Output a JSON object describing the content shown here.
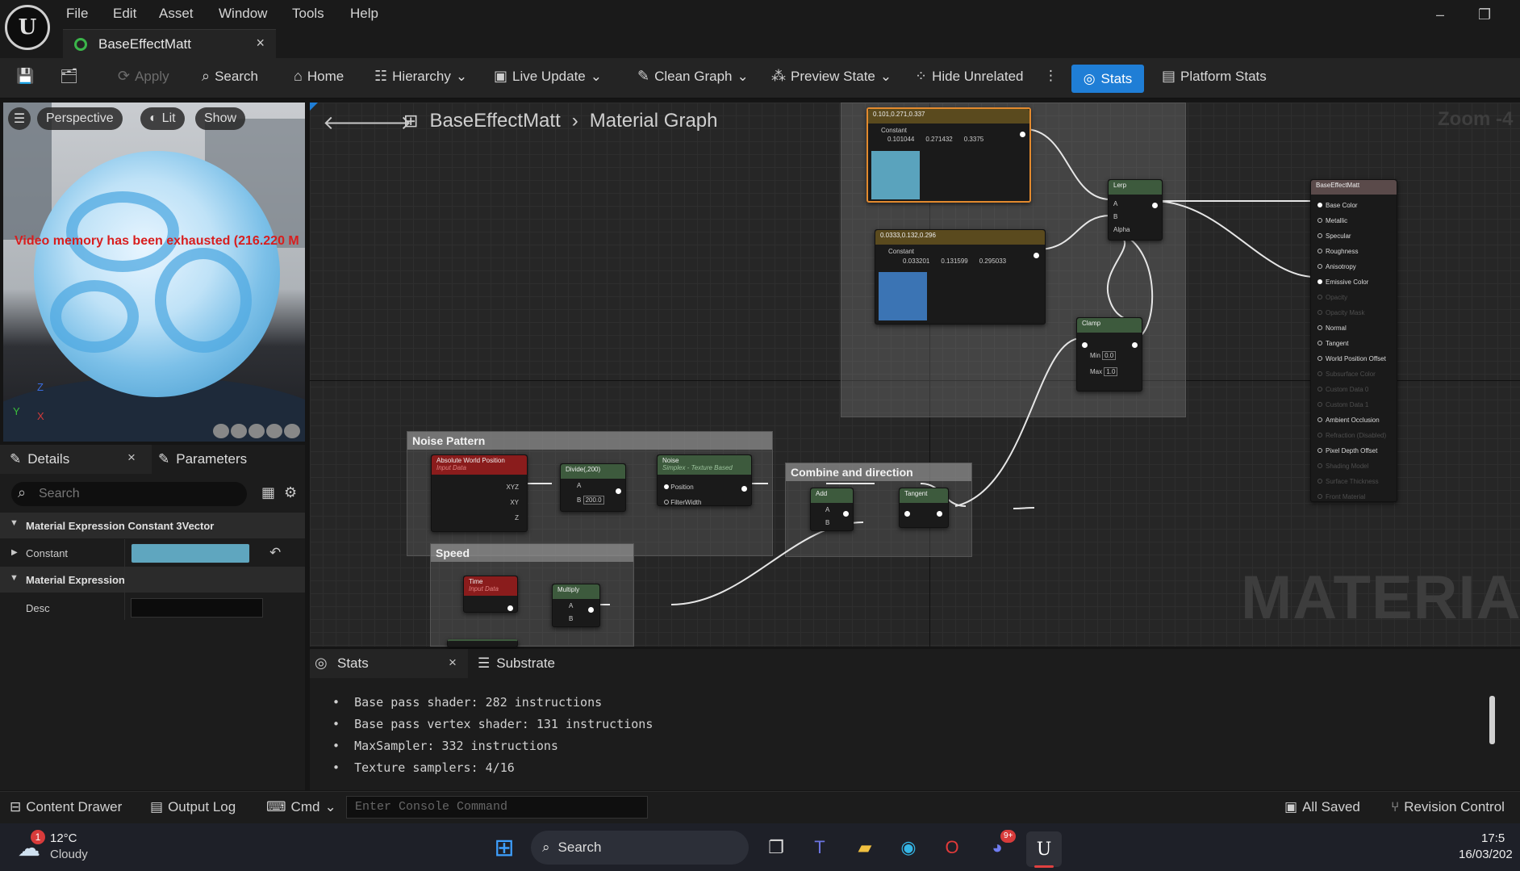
{
  "window": {
    "doc_tab": "BaseEffectMatt",
    "menu": [
      "File",
      "Edit",
      "Asset",
      "Window",
      "Tools",
      "Help"
    ]
  },
  "toolbar": {
    "apply": "Apply",
    "search": "Search",
    "home": "Home",
    "hierarchy": "Hierarchy",
    "live_update": "Live Update",
    "clean_graph": "Clean Graph",
    "preview_state": "Preview State",
    "hide_unrelated": "Hide Unrelated",
    "stats": "Stats",
    "platform_stats": "Platform Stats"
  },
  "viewport": {
    "perspective": "Perspective",
    "lit": "Lit",
    "show": "Show",
    "warning": "Video memory has been exhausted (216.220 M"
  },
  "details": {
    "tab_details": "Details",
    "tab_parameters": "Parameters",
    "search_placeholder": "Search",
    "section1": "Material Expression Constant 3Vector",
    "constant_label": "Constant",
    "constant_color": "#5fa6bf",
    "section2": "Material Expression",
    "desc_label": "Desc"
  },
  "graph": {
    "crumb_root": "BaseEffectMatt",
    "crumb_leaf": "Material Graph",
    "zoom": "Zoom -4",
    "watermark": "MATERIAL",
    "comments": {
      "noise": "Noise Pattern",
      "combine": "Combine and direction",
      "speed": "Speed"
    },
    "nodes": {
      "abs_title": "Absolute World Position",
      "abs_sub": "Input Data",
      "abs_pins": [
        "XYZ",
        "XY",
        "Z"
      ],
      "divide_title": "Divide(,200)",
      "divide_a": "A",
      "divide_b": "B",
      "divide_b_val": "200.0",
      "noise_title": "Noise",
      "noise_sub": "Simplex - Texture Based",
      "noise_pins": [
        "Position",
        "FilterWidth"
      ],
      "add_title": "Add",
      "add_pins": [
        "A",
        "B"
      ],
      "tangent_title": "Tangent",
      "time_title": "Time",
      "time_sub": "Input Data",
      "mult_title": "Multiply",
      "mult_pins": [
        "A",
        "B"
      ],
      "c1_title": "0.101,0.271,0.337",
      "c1_label": "Constant",
      "c1_vals": [
        "0.101044",
        "0.271432",
        "0.3375"
      ],
      "c1_color": "#5aa3bd",
      "c2_title": "0.0333,0.132,0.296",
      "c2_label": "Constant",
      "c2_vals": [
        "0.033201",
        "0.131599",
        "0.295033"
      ],
      "c2_color": "#3b74b4",
      "lerp_title": "Lerp",
      "lerp_pins": [
        "A",
        "B",
        "Alpha"
      ],
      "clamp_title": "Clamp",
      "clamp_min": "Min",
      "clamp_min_val": "0.0",
      "clamp_max": "Max",
      "clamp_max_val": "1.0",
      "out_title": "BaseEffectMatt",
      "out_pins": [
        "Base Color",
        "Metallic",
        "Specular",
        "Roughness",
        "Anisotropy",
        "Emissive Color",
        "Opacity",
        "Opacity Mask",
        "Normal",
        "Tangent",
        "World Position Offset",
        "Subsurface Color",
        "Custom Data 0",
        "Custom Data 1",
        "Ambient Occlusion",
        "Refraction (Disabled)",
        "Pixel Depth Offset",
        "Shading Model",
        "Surface Thickness",
        "Front Material"
      ],
      "out_enabled": [
        true,
        true,
        true,
        true,
        true,
        true,
        false,
        false,
        true,
        true,
        true,
        false,
        false,
        false,
        true,
        false,
        true,
        false,
        false,
        false
      ]
    }
  },
  "stats_panel": {
    "tab_stats": "Stats",
    "tab_substrate": "Substrate",
    "lines": [
      "Base pass shader: 282 instructions",
      "Base pass vertex shader: 131 instructions",
      "MaxSampler: 332 instructions",
      "Texture samplers: 4/16"
    ]
  },
  "statusbar": {
    "content_drawer": "Content Drawer",
    "output_log": "Output Log",
    "cmd": "Cmd",
    "console_placeholder": "Enter Console Command",
    "all_saved": "All Saved",
    "revision_control": "Revision Control"
  },
  "taskbar": {
    "temp": "12°C",
    "weather": "Cloudy",
    "weather_badge": "1",
    "search": "Search",
    "discord_badge": "9+",
    "time": "17:5",
    "date": "16/03/202"
  }
}
